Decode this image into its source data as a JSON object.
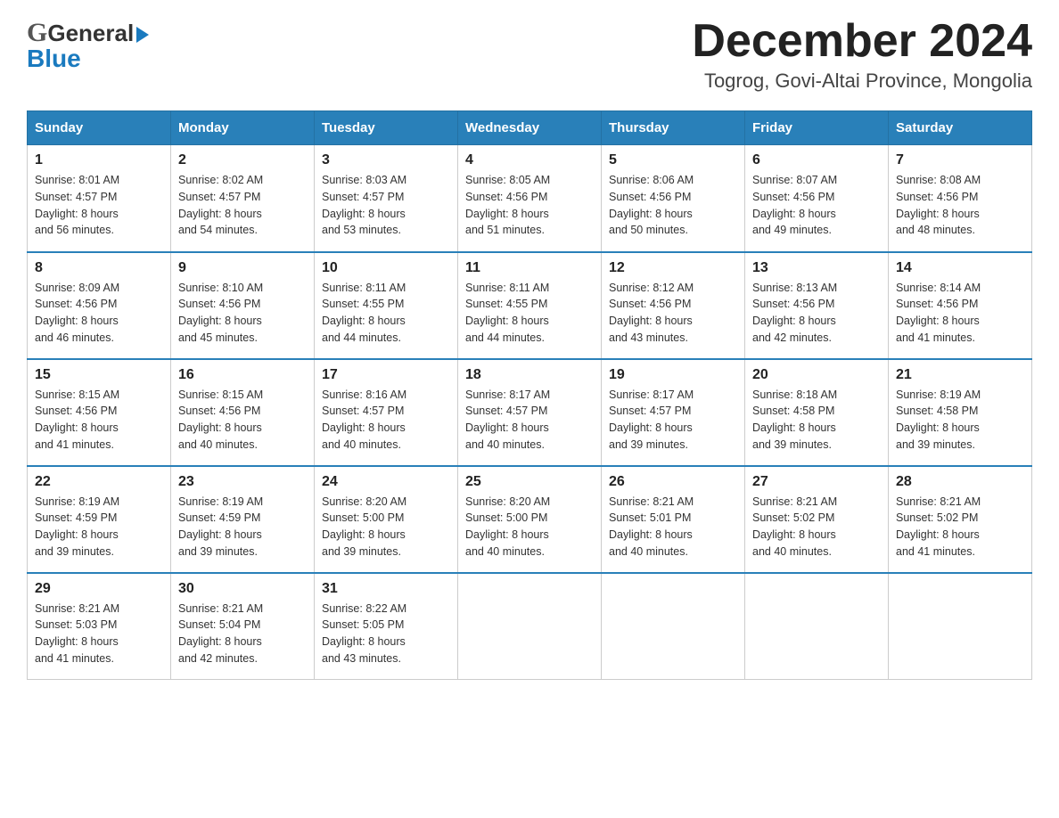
{
  "header": {
    "logo_general": "General",
    "logo_blue": "Blue",
    "month_title": "December 2024",
    "location": "Togrog, Govi-Altai Province, Mongolia"
  },
  "weekdays": [
    "Sunday",
    "Monday",
    "Tuesday",
    "Wednesday",
    "Thursday",
    "Friday",
    "Saturday"
  ],
  "weeks": [
    [
      {
        "day": "1",
        "sunrise": "8:01 AM",
        "sunset": "4:57 PM",
        "daylight": "8 hours and 56 minutes."
      },
      {
        "day": "2",
        "sunrise": "8:02 AM",
        "sunset": "4:57 PM",
        "daylight": "8 hours and 54 minutes."
      },
      {
        "day": "3",
        "sunrise": "8:03 AM",
        "sunset": "4:57 PM",
        "daylight": "8 hours and 53 minutes."
      },
      {
        "day": "4",
        "sunrise": "8:05 AM",
        "sunset": "4:56 PM",
        "daylight": "8 hours and 51 minutes."
      },
      {
        "day": "5",
        "sunrise": "8:06 AM",
        "sunset": "4:56 PM",
        "daylight": "8 hours and 50 minutes."
      },
      {
        "day": "6",
        "sunrise": "8:07 AM",
        "sunset": "4:56 PM",
        "daylight": "8 hours and 49 minutes."
      },
      {
        "day": "7",
        "sunrise": "8:08 AM",
        "sunset": "4:56 PM",
        "daylight": "8 hours and 48 minutes."
      }
    ],
    [
      {
        "day": "8",
        "sunrise": "8:09 AM",
        "sunset": "4:56 PM",
        "daylight": "8 hours and 46 minutes."
      },
      {
        "day": "9",
        "sunrise": "8:10 AM",
        "sunset": "4:56 PM",
        "daylight": "8 hours and 45 minutes."
      },
      {
        "day": "10",
        "sunrise": "8:11 AM",
        "sunset": "4:55 PM",
        "daylight": "8 hours and 44 minutes."
      },
      {
        "day": "11",
        "sunrise": "8:11 AM",
        "sunset": "4:55 PM",
        "daylight": "8 hours and 44 minutes."
      },
      {
        "day": "12",
        "sunrise": "8:12 AM",
        "sunset": "4:56 PM",
        "daylight": "8 hours and 43 minutes."
      },
      {
        "day": "13",
        "sunrise": "8:13 AM",
        "sunset": "4:56 PM",
        "daylight": "8 hours and 42 minutes."
      },
      {
        "day": "14",
        "sunrise": "8:14 AM",
        "sunset": "4:56 PM",
        "daylight": "8 hours and 41 minutes."
      }
    ],
    [
      {
        "day": "15",
        "sunrise": "8:15 AM",
        "sunset": "4:56 PM",
        "daylight": "8 hours and 41 minutes."
      },
      {
        "day": "16",
        "sunrise": "8:15 AM",
        "sunset": "4:56 PM",
        "daylight": "8 hours and 40 minutes."
      },
      {
        "day": "17",
        "sunrise": "8:16 AM",
        "sunset": "4:57 PM",
        "daylight": "8 hours and 40 minutes."
      },
      {
        "day": "18",
        "sunrise": "8:17 AM",
        "sunset": "4:57 PM",
        "daylight": "8 hours and 40 minutes."
      },
      {
        "day": "19",
        "sunrise": "8:17 AM",
        "sunset": "4:57 PM",
        "daylight": "8 hours and 39 minutes."
      },
      {
        "day": "20",
        "sunrise": "8:18 AM",
        "sunset": "4:58 PM",
        "daylight": "8 hours and 39 minutes."
      },
      {
        "day": "21",
        "sunrise": "8:19 AM",
        "sunset": "4:58 PM",
        "daylight": "8 hours and 39 minutes."
      }
    ],
    [
      {
        "day": "22",
        "sunrise": "8:19 AM",
        "sunset": "4:59 PM",
        "daylight": "8 hours and 39 minutes."
      },
      {
        "day": "23",
        "sunrise": "8:19 AM",
        "sunset": "4:59 PM",
        "daylight": "8 hours and 39 minutes."
      },
      {
        "day": "24",
        "sunrise": "8:20 AM",
        "sunset": "5:00 PM",
        "daylight": "8 hours and 39 minutes."
      },
      {
        "day": "25",
        "sunrise": "8:20 AM",
        "sunset": "5:00 PM",
        "daylight": "8 hours and 40 minutes."
      },
      {
        "day": "26",
        "sunrise": "8:21 AM",
        "sunset": "5:01 PM",
        "daylight": "8 hours and 40 minutes."
      },
      {
        "day": "27",
        "sunrise": "8:21 AM",
        "sunset": "5:02 PM",
        "daylight": "8 hours and 40 minutes."
      },
      {
        "day": "28",
        "sunrise": "8:21 AM",
        "sunset": "5:02 PM",
        "daylight": "8 hours and 41 minutes."
      }
    ],
    [
      {
        "day": "29",
        "sunrise": "8:21 AM",
        "sunset": "5:03 PM",
        "daylight": "8 hours and 41 minutes."
      },
      {
        "day": "30",
        "sunrise": "8:21 AM",
        "sunset": "5:04 PM",
        "daylight": "8 hours and 42 minutes."
      },
      {
        "day": "31",
        "sunrise": "8:22 AM",
        "sunset": "5:05 PM",
        "daylight": "8 hours and 43 minutes."
      },
      null,
      null,
      null,
      null
    ]
  ],
  "labels": {
    "sunrise": "Sunrise:",
    "sunset": "Sunset:",
    "daylight": "Daylight:"
  }
}
